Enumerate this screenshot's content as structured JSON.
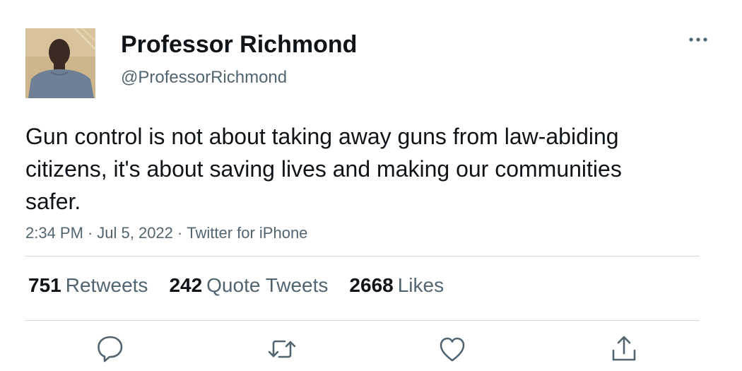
{
  "user": {
    "display_name": "Professor Richmond",
    "handle": "@ProfessorRichmond"
  },
  "tweet": {
    "text": "Gun control is not about taking away guns from law-abiding citizens, it's about saving lives and making our communities safer.",
    "time": "2:34 PM",
    "separator": "·",
    "date": "Jul 5, 2022",
    "source": "Twitter for iPhone"
  },
  "stats": {
    "retweets_count": "751",
    "retweets_label": "Retweets",
    "quotes_count": "242",
    "quotes_label": "Quote Tweets",
    "likes_count": "2668",
    "likes_label": "Likes"
  },
  "icons": {
    "more": "more-horizontal-icon",
    "reply": "reply-icon",
    "retweet": "retweet-icon",
    "like": "heart-icon",
    "share": "share-icon"
  },
  "colors": {
    "primary_text": "#0f1419",
    "secondary_text": "#536471",
    "divider": "#cfd9de",
    "icon": "#536471"
  }
}
